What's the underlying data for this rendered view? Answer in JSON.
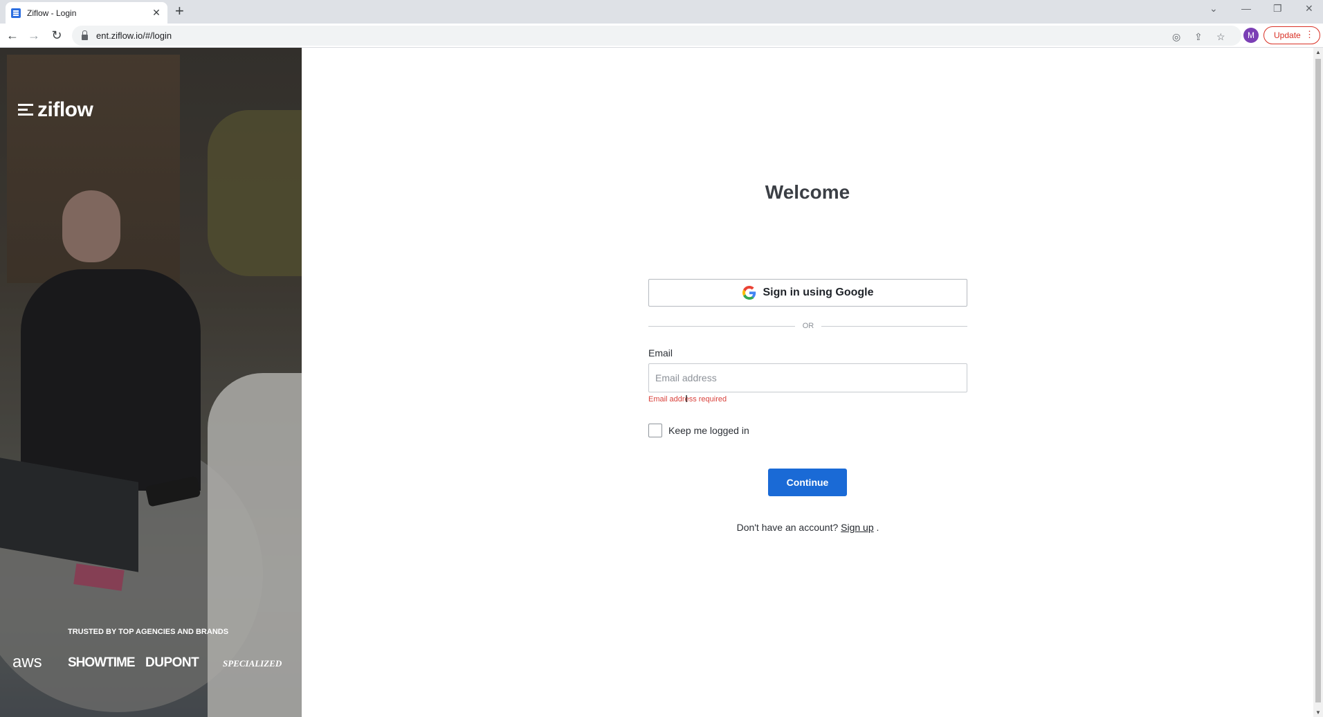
{
  "browser": {
    "tab_title": "Ziflow - Login",
    "tab_close": "✕",
    "new_tab": "+",
    "url": "ent.ziflow.io/#/login",
    "profile_initial": "M",
    "update_label": "Update",
    "icons": [
      "back-icon",
      "forward-icon",
      "reload-icon",
      "lock-icon",
      "eye-off-icon",
      "share-icon",
      "star-icon",
      "kebab-menu-icon",
      "minimize-icon",
      "restore-icon",
      "close-icon",
      "tab-search-icon"
    ]
  },
  "hero": {
    "brand_name": "ziflow",
    "trusted_label": "TRUSTED BY TOP AGENCIES AND BRANDS",
    "brands": [
      "aws",
      "SHOWTIME",
      "DUPONT",
      "SPECIALIZED"
    ]
  },
  "login": {
    "heading": "Welcome",
    "google_button": "Sign in using Google",
    "divider": "OR",
    "email_label": "Email",
    "email_placeholder": "Email address",
    "email_value": "",
    "email_error": "Email address required",
    "keep_logged_in": "Keep me logged in",
    "keep_logged_in_checked": false,
    "continue_button": "Continue",
    "no_account_text": "Don't have an account?",
    "signup_link": "Sign up",
    "signup_suffix": "."
  },
  "colors": {
    "primary": "#1a6ad6",
    "error": "#d9413b",
    "heading": "#3b3f45",
    "update_accent": "#d93025"
  }
}
